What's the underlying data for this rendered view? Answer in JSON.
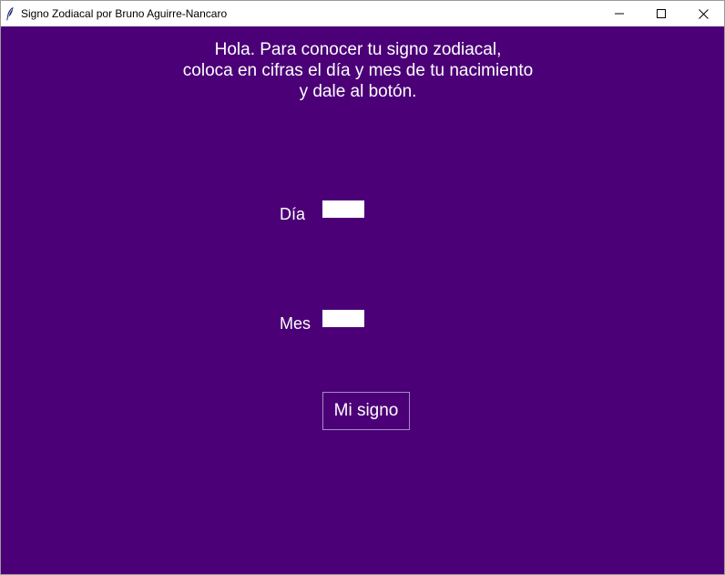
{
  "window": {
    "title": "Signo Zodiacal por Bruno Aguirre-Nancaro",
    "app_icon": "feather-icon",
    "controls": {
      "minimize_icon": "minimize-icon",
      "maximize_icon": "maximize-icon",
      "close_icon": "close-icon"
    }
  },
  "main": {
    "greeting_lines": [
      "Hola. Para conocer tu signo zodiacal,",
      "coloca en cifras el día y mes de tu nacimiento",
      "y dale al botón."
    ],
    "day_label": "Día",
    "day_value": "",
    "month_label": "Mes",
    "month_value": "",
    "submit_label": "Mi signo"
  },
  "colors": {
    "background": "#4b0077",
    "text": "#ffffff",
    "input_background": "#ffffff"
  }
}
